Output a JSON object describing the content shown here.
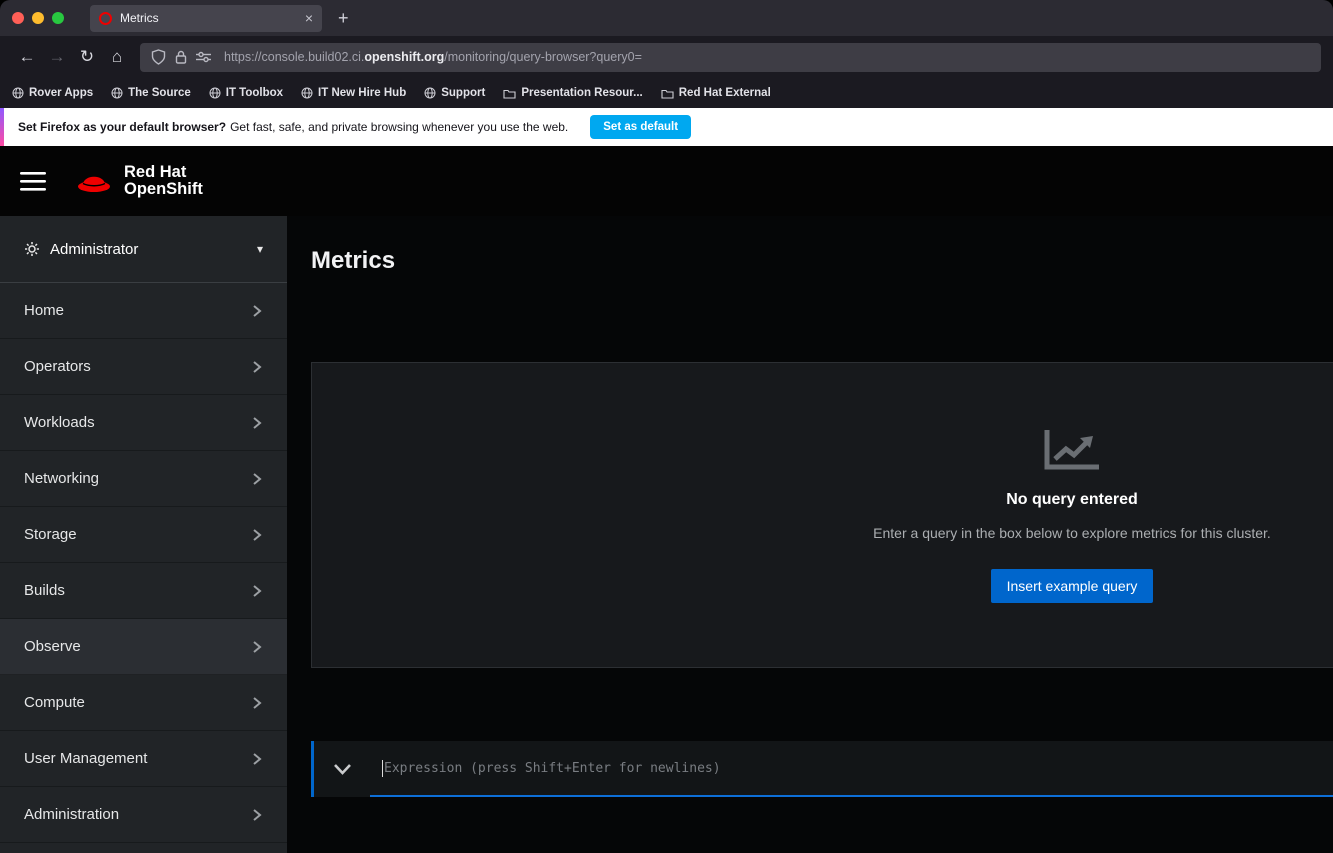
{
  "colors": {
    "accent_blue": "#0066cc",
    "redhat_red": "#ee0000",
    "notification_button_blue": "#00a8f0",
    "traffic_red": "#ff5f57",
    "traffic_yellow": "#febc2e",
    "traffic_green": "#28c840"
  },
  "icons": {
    "back": "←",
    "forward": "→",
    "reload": "↻",
    "home": "⌂",
    "new_tab": "+",
    "close_tab": "×",
    "caret_down": "▾"
  },
  "browser": {
    "tab_title": "Metrics",
    "url_prefix": "https://console.build02.ci.",
    "url_domain": "openshift.org",
    "url_suffix": "/monitoring/query-browser?query0=",
    "bookmarks": [
      "Rover Apps",
      "The Source",
      "IT Toolbox",
      "IT New Hire Hub",
      "Support",
      "Presentation Resour...",
      "Red Hat External"
    ],
    "notification_bold": "Set Firefox as your default browser?",
    "notification_text": "Get fast, safe, and private browsing whenever you use the web.",
    "notification_button": "Set as default"
  },
  "masthead": {
    "brand_line1": "Red Hat",
    "brand_line2": "OpenShift"
  },
  "sidebar": {
    "perspective": "Administrator",
    "items": [
      "Home",
      "Operators",
      "Workloads",
      "Networking",
      "Storage",
      "Builds",
      "Observe",
      "Compute",
      "User Management",
      "Administration"
    ],
    "active_item": "Observe"
  },
  "main": {
    "title": "Metrics",
    "empty_heading": "No query entered",
    "empty_description": "Enter a query in the box below to explore metrics for this cluster.",
    "empty_button": "Insert example query",
    "query_placeholder": "Expression (press Shift+Enter for newlines)"
  }
}
